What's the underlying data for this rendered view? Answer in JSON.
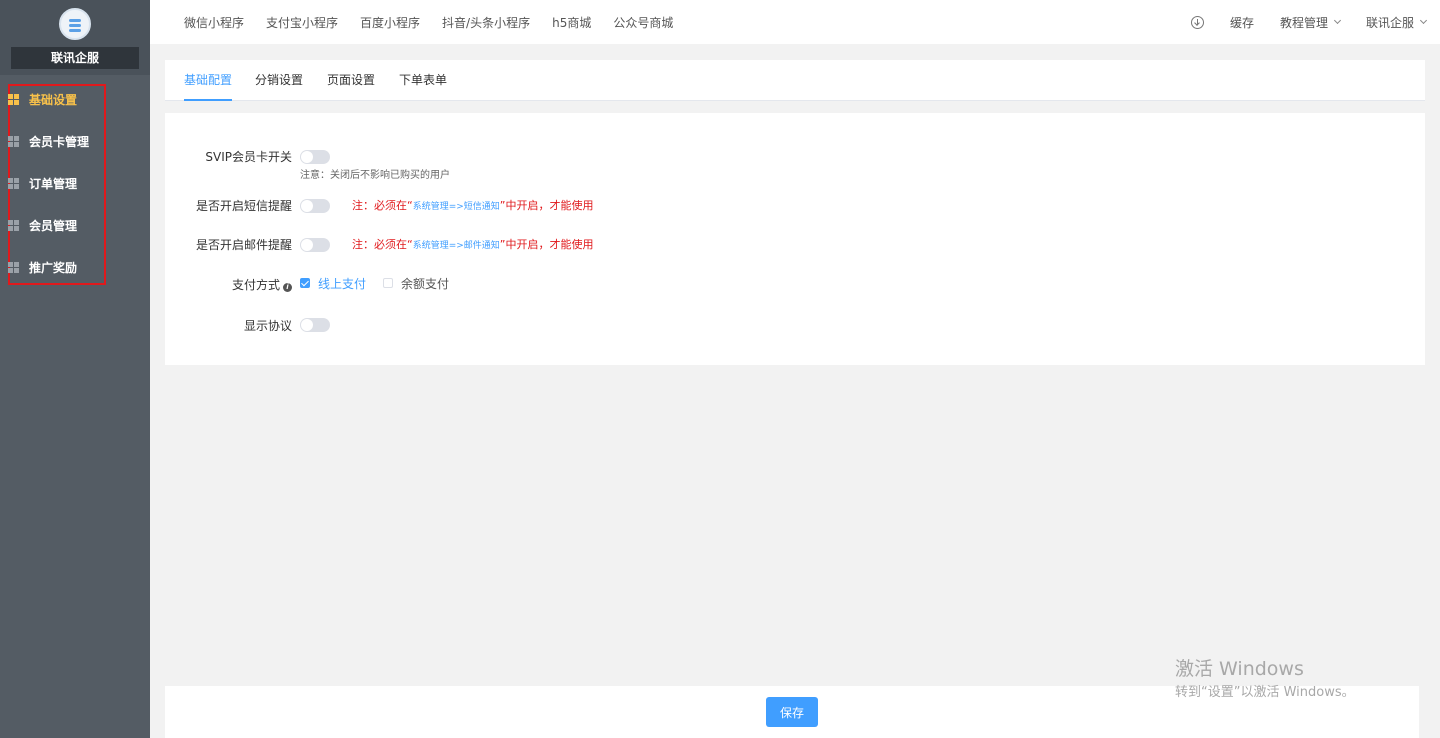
{
  "sidebar": {
    "company": "联讯企服",
    "items": [
      {
        "label": "基础设置",
        "active": true
      },
      {
        "label": "会员卡管理",
        "active": false
      },
      {
        "label": "订单管理",
        "active": false
      },
      {
        "label": "会员管理",
        "active": false
      },
      {
        "label": "推广奖励",
        "active": false
      }
    ]
  },
  "topbar": {
    "links": [
      "微信小程序",
      "支付宝小程序",
      "百度小程序",
      "抖音/头条小程序",
      "h5商城",
      "公众号商城"
    ],
    "cache": "缓存",
    "tutorial": "教程管理",
    "user": "联讯企服"
  },
  "tabs": [
    "基础配置",
    "分销设置",
    "页面设置",
    "下单表单"
  ],
  "form": {
    "svip_label": "SVIP会员卡开关",
    "svip_hint": "注意：关闭后不影响已购买的用户",
    "sms_label": "是否开启短信提醒",
    "sms_note_prefix": "注：必须在“",
    "sms_note_path": "系统管理=>短信通知",
    "sms_note_suffix": "”中开启，才能使用",
    "mail_label": "是否开启邮件提醒",
    "mail_note_prefix": "注：必须在“",
    "mail_note_path": "系统管理=>邮件通知",
    "mail_note_suffix": "”中开启，才能使用",
    "pay_label": "支付方式",
    "pay_online": "线上支付",
    "pay_balance": "余额支付",
    "agreement_label": "显示协议"
  },
  "footer": {
    "save_label": "保存"
  },
  "watermark": {
    "line1": "激活 Windows",
    "line2": "转到“设置”以激活 Windows。"
  },
  "colors": {
    "accent": "#409eff",
    "warning": "#e0191c",
    "sidebar": "#545c64",
    "active_menu": "#f8c14a"
  },
  "icons": {
    "menu_item": "grid-icon",
    "download": "download-icon",
    "info": "info-icon",
    "dropdown": "chevron-down-icon"
  }
}
